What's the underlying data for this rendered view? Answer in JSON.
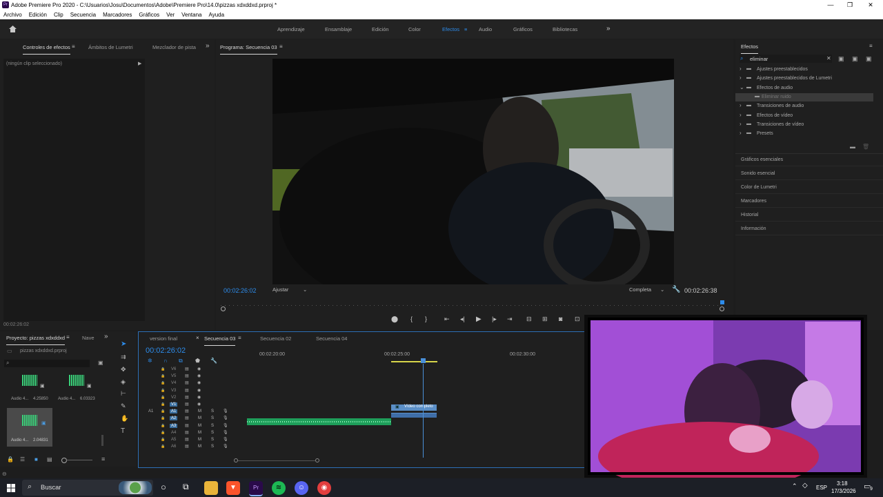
{
  "window": {
    "title": "Adobe Premiere Pro 2020 - C:\\Usuarios\\Josu\\Documentos\\Adobe\\Premiere Pro\\14.0\\pizzas xdxddxd.prproj *",
    "logo_text": "Pr",
    "minimize": "—",
    "maximize": "❐",
    "close": "✕"
  },
  "menu": [
    "Archivo",
    "Edición",
    "Clip",
    "Secuencia",
    "Marcadores",
    "Gráficos",
    "Ver",
    "Ventana",
    "Ayuda"
  ],
  "workspaces": {
    "items": [
      "Aprendizaje",
      "Ensamblaje",
      "Edición",
      "Color",
      "Efectos",
      "Audio",
      "Gráficos",
      "Bibliotecas"
    ],
    "active": "Efectos",
    "more": "»"
  },
  "effect_controls": {
    "tabs": [
      "Controles de efectos",
      "Ámbitos de Lumetri",
      "Mezclador de pista"
    ],
    "no_clip": "(ningún clip seleccionado)",
    "timecode": "00:02:26:02"
  },
  "program": {
    "title": "Programa: Secuencia 03",
    "timecode": "00:02:26:02",
    "fit": "Ajustar",
    "quality": "Completa",
    "duration": "00:02:26:38"
  },
  "effects_panel": {
    "title": "Efectos",
    "search_value": "eliminar",
    "tree": [
      {
        "label": "Ajustes preestablecidos",
        "indent": 0,
        "open": false
      },
      {
        "label": "Ajustes preestablecidos de Lumetri",
        "indent": 0,
        "open": false
      },
      {
        "label": "Efectos de audio",
        "indent": 0,
        "open": true
      },
      {
        "label": "Eliminar ruido",
        "indent": 1,
        "open": false
      },
      {
        "label": "Transiciones de audio",
        "indent": 0,
        "open": false
      },
      {
        "label": "Efectos de vídeo",
        "indent": 0,
        "open": false
      },
      {
        "label": "Transiciones de vídeo",
        "indent": 0,
        "open": false
      },
      {
        "label": "Presets",
        "indent": 0,
        "open": false
      }
    ],
    "collapsed_panels": [
      "Gráficos esenciales",
      "Sonido esencial",
      "Color de Lumetri",
      "Marcadores",
      "Historial",
      "Información"
    ]
  },
  "project": {
    "tabs": [
      "Proyecto: pizzas xdxddxd",
      "Nave"
    ],
    "file": "pizzas xdxddxd.prproj",
    "items": [
      {
        "name": "Audio 4...",
        "duration": "4.25850"
      },
      {
        "name": "Audio 4...",
        "duration": "6.03323"
      },
      {
        "name": "Audio 4...",
        "duration": "2.04831"
      }
    ]
  },
  "timeline": {
    "tabs": [
      "version final",
      "Secuencia 03",
      "Secuencia 02",
      "Secuencia 04"
    ],
    "active_tab": "Secuencia 03",
    "timecode": "00:02:26:02",
    "ruler": [
      "00:02:20:00",
      "00:02:25:00",
      "00:02:30:00"
    ],
    "video_tracks": [
      "V6",
      "V5",
      "V4",
      "V3",
      "V2",
      "V1"
    ],
    "audio_tracks": [
      "A1",
      "A2",
      "A3",
      "A4",
      "A5",
      "A6"
    ],
    "source_patch": "A1",
    "clip_label": "Vídeo completo"
  },
  "taskbar": {
    "search_placeholder": "Buscar",
    "lang": "ESP",
    "time": "3:18",
    "date": "17/3/2026",
    "notifications": "9"
  },
  "colors": {
    "accent": "#2d8ceb",
    "audio_clip": "#1e9e5a",
    "video_clip": "#5b8fc7",
    "playhead": "#4a90d9"
  }
}
